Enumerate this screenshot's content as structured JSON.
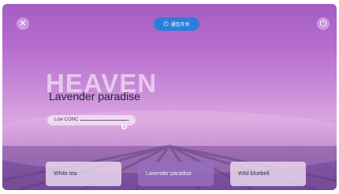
{
  "header": {
    "close_icon": "close-icon",
    "power_icon": "power-icon",
    "status_label": "通信开关",
    "status_color": "#2b7fd9"
  },
  "hero": {
    "backdrop_word": "HEAVEN",
    "scene_name": "Lavender paradise"
  },
  "concentration": {
    "label": "Low CONC",
    "value_display": "3",
    "level_fraction": 0.95
  },
  "scenes": {
    "items": [
      {
        "label": "White tea"
      },
      {
        "label": "Lavender paradise"
      },
      {
        "label": "Wild bluebell"
      }
    ],
    "selected_index": 1
  },
  "colors": {
    "sky_top": "#a55dc3",
    "field": "#6e4690",
    "card_bg": "#ecdcee",
    "card_selected": "#966ebe"
  }
}
